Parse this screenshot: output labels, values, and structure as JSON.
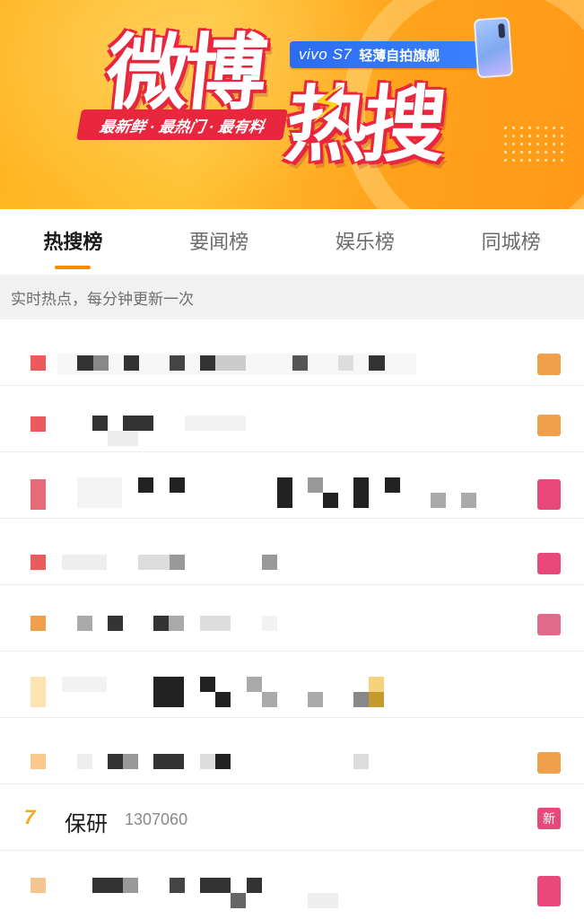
{
  "banner": {
    "logo_word_1": "微博",
    "logo_word_2": "热搜",
    "tagline": "最新鲜 · 最热门 · 最有料",
    "sponsor_brand": "vivo S7",
    "sponsor_slogan": "轻薄自拍旗舰",
    "colors": {
      "background": "#ffb31f",
      "accent": "#e8273f",
      "badge": "#2b6cf0"
    }
  },
  "tabs": [
    {
      "label": "热搜榜",
      "active": true
    },
    {
      "label": "要闻榜",
      "active": false
    },
    {
      "label": "娱乐榜",
      "active": false
    },
    {
      "label": "同城榜",
      "active": false
    }
  ],
  "subheader": "实时热点，每分钟更新一次",
  "list": {
    "visible_row": {
      "rank": "7",
      "title": "保研",
      "heat": "1307060",
      "tag": "新"
    },
    "obscured_rows_note": "pixelated",
    "rank_colors": [
      "#ec5b5b",
      "#ec5b5b",
      "#e56b78",
      "#ec5b5b",
      "#f0a04b",
      "#fde3b2",
      "#f8c98a",
      "#f5a623",
      "#f3c690"
    ],
    "tag_colors": {
      "hot": "#f0a04b",
      "new": "#e8487a"
    }
  }
}
